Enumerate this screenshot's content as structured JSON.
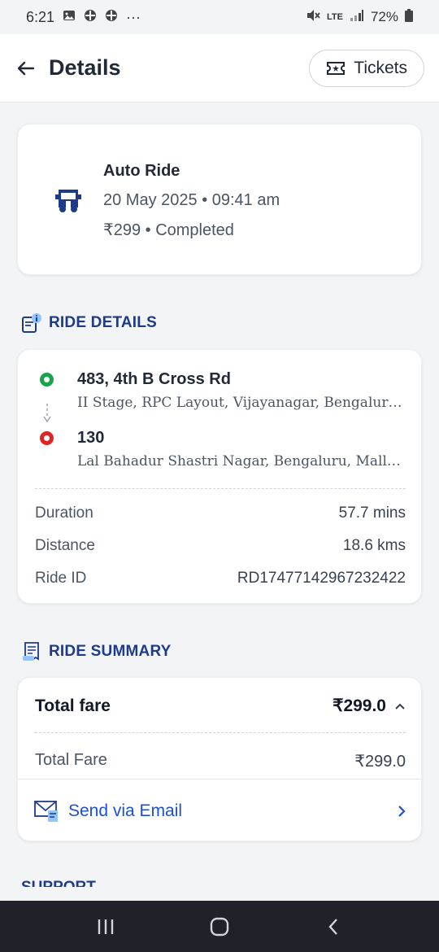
{
  "status_bar": {
    "time": "6:21",
    "dots": "···",
    "network": "LTE",
    "battery": "72%"
  },
  "header": {
    "title": "Details",
    "tickets_label": "Tickets"
  },
  "ride": {
    "type": "Auto Ride",
    "datetime": "20 May 2025 • 09:41 am",
    "fare_status": "₹299 • Completed",
    "icon": "auto-rickshaw-icon"
  },
  "ride_details": {
    "heading": "RIDE DETAILS",
    "pickup": {
      "title": "483, 4th B Cross Rd",
      "subtitle": "II Stage, RPC Layout, Vijayanagar, Bengaluru, Karnataka"
    },
    "drop": {
      "title": "130",
      "subtitle": "Lal Bahadur Shastri Nagar, Bengaluru, Mallasandra"
    },
    "rows": [
      {
        "label": "Duration",
        "value": "57.7 mins"
      },
      {
        "label": "Distance",
        "value": "18.6 kms"
      },
      {
        "label": "Ride ID",
        "value": "RD17477142967232422"
      }
    ]
  },
  "ride_summary": {
    "heading": "RIDE SUMMARY",
    "total_label": "Total fare",
    "total_value": "₹299.0",
    "line_label": "Total Fare",
    "line_value": "₹299.0",
    "email_label": "Send via Email"
  },
  "support": {
    "heading": "SUPPORT"
  },
  "colors": {
    "pickup": "#16a34a",
    "drop": "#dc2626",
    "accent": "#1d4ed8",
    "heading": "#1e3a8a"
  }
}
